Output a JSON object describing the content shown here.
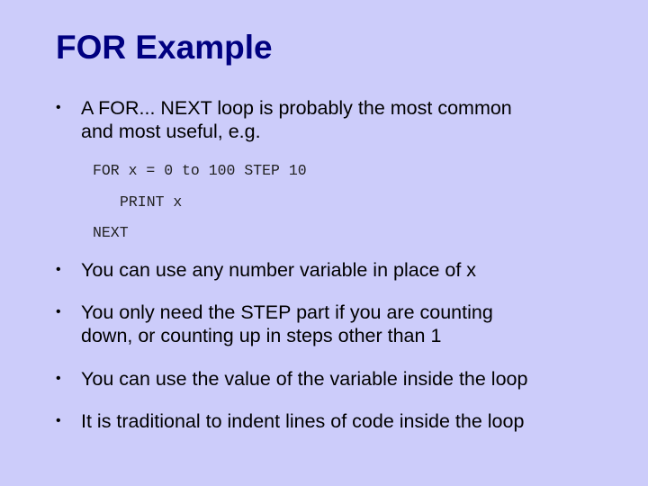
{
  "slide": {
    "title": "FOR Example",
    "bullets": [
      {
        "lines": [
          "A FOR... NEXT loop is probably the most common",
          "and most useful, e.g."
        ]
      },
      {
        "lines": [
          "You can use any number variable in place of x"
        ]
      },
      {
        "lines": [
          "You only need the STEP part if you are counting",
          "down, or counting up in steps other than 1"
        ]
      },
      {
        "lines": [
          "You can use the value of the variable inside the loop"
        ]
      },
      {
        "lines": [
          "It is traditional to indent lines of code inside the loop"
        ]
      }
    ],
    "bullet_glyph": "•",
    "code": [
      "FOR x = 0 to 100 STEP 10",
      "PRINT x",
      "NEXT"
    ],
    "colors": {
      "background": "#ccccfa",
      "title": "#000080",
      "body": "#000000"
    }
  }
}
